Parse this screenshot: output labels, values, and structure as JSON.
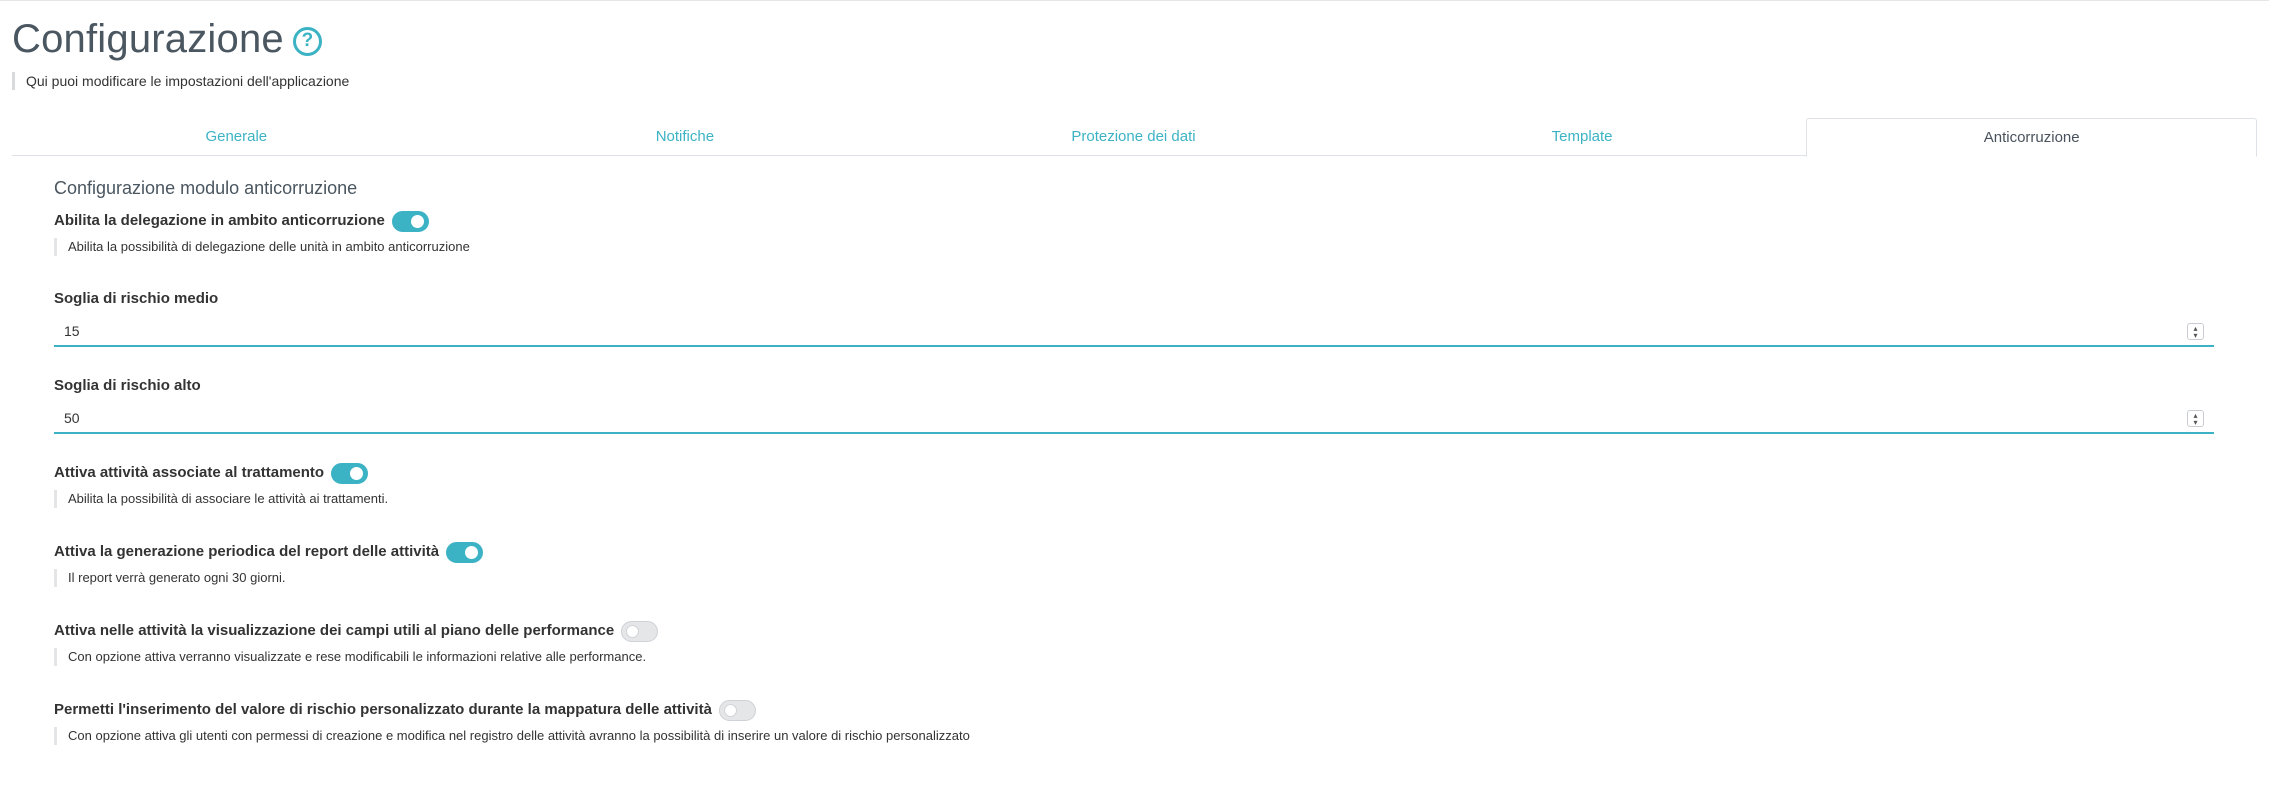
{
  "page": {
    "title": "Configurazione",
    "subtitle": "Qui puoi modificare le impostazioni dell'applicazione",
    "help_icon_glyph": "?"
  },
  "tabs": [
    {
      "label": "Generale",
      "active": false
    },
    {
      "label": "Notifiche",
      "active": false
    },
    {
      "label": "Protezione dei dati",
      "active": false
    },
    {
      "label": "Template",
      "active": false
    },
    {
      "label": "Anticorruzione",
      "active": true
    }
  ],
  "section": {
    "title": "Configurazione modulo anticorruzione"
  },
  "settings": {
    "delegation": {
      "label": "Abilita la delegazione in ambito anticorruzione",
      "enabled": true,
      "help": "Abilita la possibilità di delegazione delle unità in ambito anticorruzione"
    },
    "medium_risk": {
      "label": "Soglia di rischio medio",
      "value": "15"
    },
    "high_risk": {
      "label": "Soglia di rischio alto",
      "value": "50"
    },
    "activities_treatment": {
      "label": "Attiva attività associate al trattamento",
      "enabled": true,
      "help": "Abilita la possibilità di associare le attività ai trattamenti."
    },
    "periodic_report": {
      "label": "Attiva la generazione periodica del report delle attività",
      "enabled": true,
      "help": "Il report verrà generato ogni 30 giorni."
    },
    "performance_fields": {
      "label": "Attiva nelle attività la visualizzazione dei campi utili al piano delle performance",
      "enabled": false,
      "help": "Con opzione attiva verranno visualizzate e rese modificabili le informazioni relative alle performance."
    },
    "custom_risk": {
      "label": "Permetti l'inserimento del valore di rischio personalizzato durante la mappatura delle attività",
      "enabled": false,
      "help": "Con opzione attiva gli utenti con permessi di creazione e modifica nel registro delle attività avranno la possibilità di inserire un valore di rischio personalizzato"
    }
  },
  "colors": {
    "accent": "#3cb3c4",
    "text": "#333333",
    "title": "#4a5660"
  }
}
